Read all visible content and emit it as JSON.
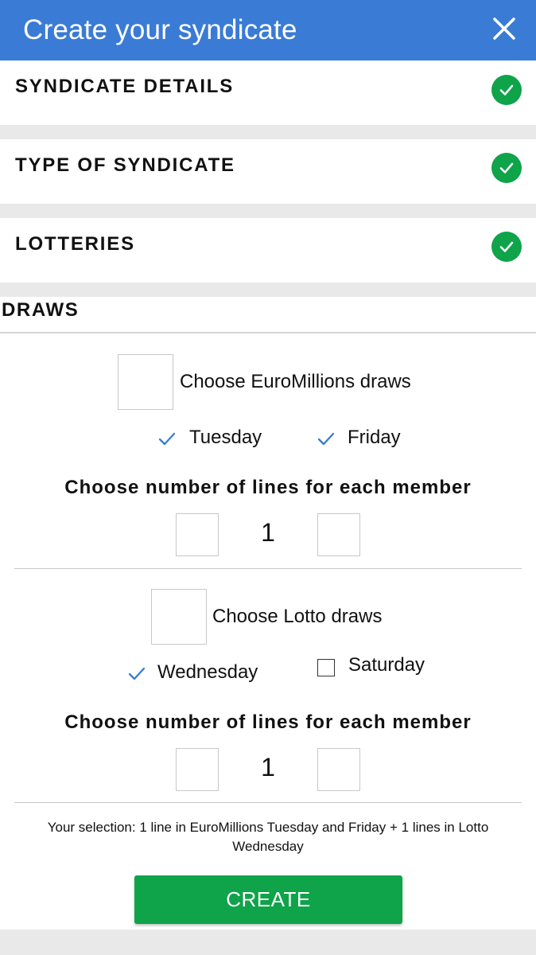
{
  "header": {
    "title": "Create your syndicate",
    "close_icon": "close-icon"
  },
  "sections": [
    {
      "label": "SYNDICATE DETAILS",
      "status": "complete"
    },
    {
      "label": "TYPE OF SYNDICATE",
      "status": "complete"
    },
    {
      "label": "LOTTERIES",
      "status": "complete"
    }
  ],
  "draws": {
    "title": "DRAWS",
    "groups": [
      {
        "choose_label": "Choose EuroMillions draws",
        "days": [
          {
            "label": "Tuesday",
            "checked": true
          },
          {
            "label": "Friday",
            "checked": true
          }
        ],
        "lines_heading": "Choose number of lines for each member",
        "lines_value": "1"
      },
      {
        "choose_label": "Choose Lotto draws",
        "days": [
          {
            "label": "Wednesday",
            "checked": true
          },
          {
            "label": "Saturday",
            "checked": false
          }
        ],
        "lines_heading": "Choose number of lines for each member",
        "lines_value": "1"
      }
    ],
    "summary": "Your selection: 1 line in EuroMillions Tuesday and Friday + 1 lines in Lotto Wednesday",
    "create_label": "CREATE"
  },
  "colors": {
    "header": "#3a7bd5",
    "success": "#0fa34a",
    "check": "#3a7bd5"
  }
}
